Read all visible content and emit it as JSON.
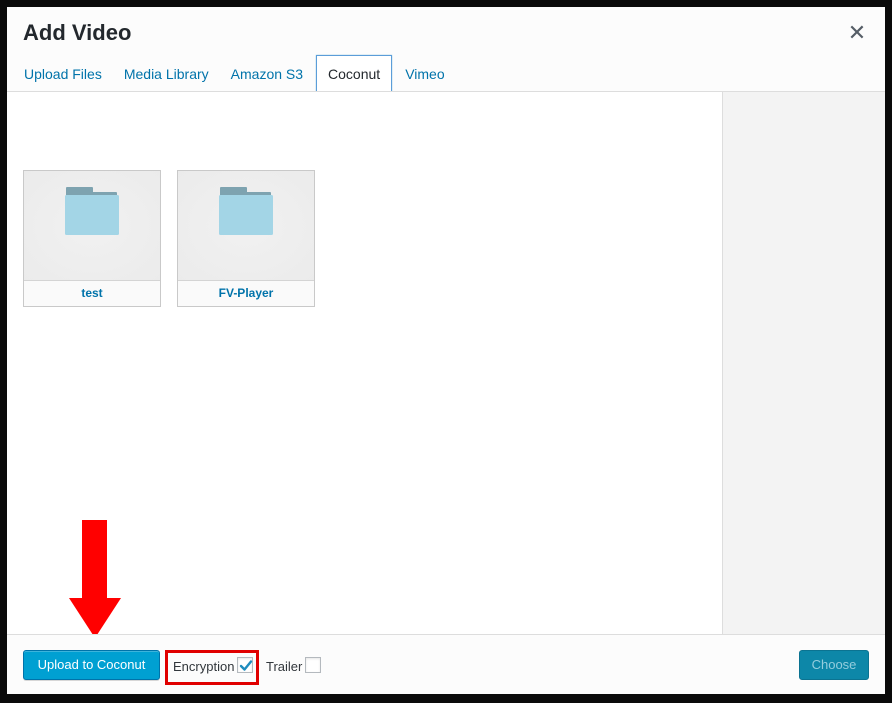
{
  "dialog": {
    "title": "Add Video",
    "close_icon": "close-icon"
  },
  "tabs": [
    {
      "label": "Upload Files",
      "active": false
    },
    {
      "label": "Media Library",
      "active": false
    },
    {
      "label": "Amazon S3",
      "active": false
    },
    {
      "label": "Coconut",
      "active": true
    },
    {
      "label": "Vimeo",
      "active": false
    }
  ],
  "folders": [
    {
      "name": "test",
      "icon": "folder-icon"
    },
    {
      "name": "FV-Player",
      "icon": "folder-icon"
    }
  ],
  "footer": {
    "upload_button_label": "Upload to Coconut",
    "encryption_label": "Encryption",
    "encryption_checked": true,
    "trailer_label": "Trailer",
    "trailer_checked": false,
    "choose_button_label": "Choose",
    "choose_disabled": true
  },
  "annotation": {
    "arrow_icon": "red-arrow-down-icon",
    "highlight_color": "#e00000"
  },
  "colors": {
    "primary": "#00a0d2",
    "link": "#0073aa",
    "folder_body": "#a3d5e6",
    "folder_tab": "#7ea3b0"
  }
}
